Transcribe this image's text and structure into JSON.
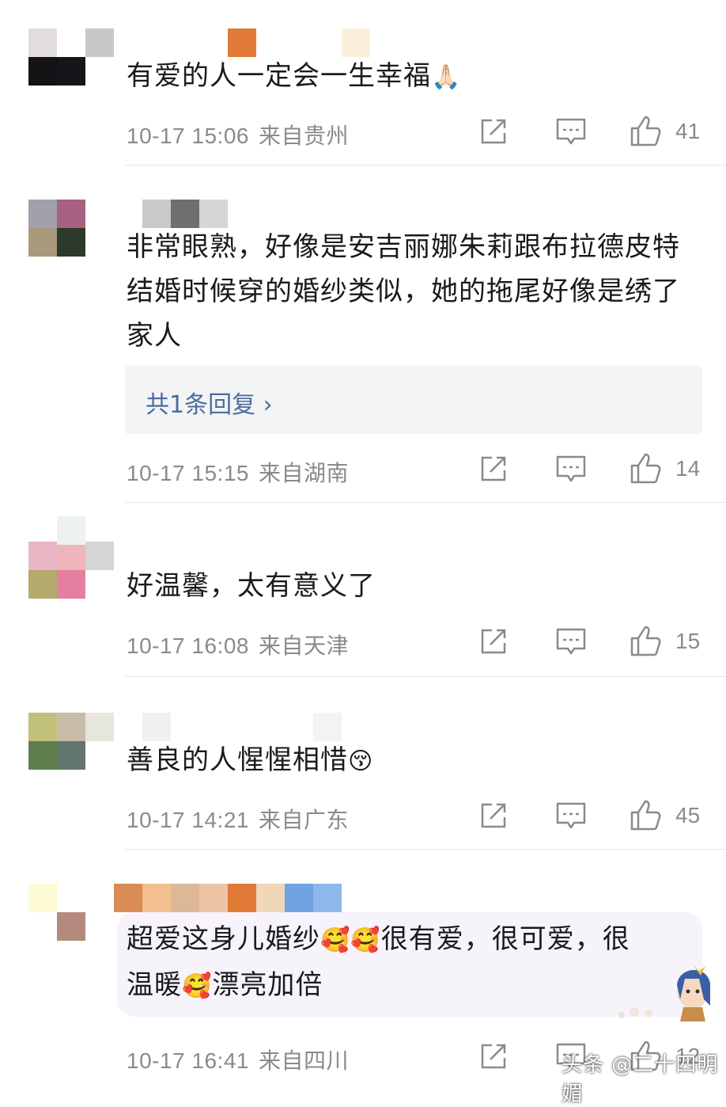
{
  "comments": [
    {
      "text": "有爱的人一定会一生幸福",
      "emoji": "🙏🏻",
      "date": "10-17 15:06",
      "location": "来自贵州",
      "likes": "41",
      "avatar_colors": [
        "#e2dce0",
        "#c7c9c8",
        "#131214",
        "#15161a"
      ],
      "name_colors": [
        "#f0f0f0",
        "#e07a36",
        "#fbefdc"
      ]
    },
    {
      "text": "非常眼熟，好像是安吉丽娜朱莉跟布拉德皮特结婚时候穿的婚纱类似，她的拖尾好像是绣了家人",
      "reply_label": "共1条回复",
      "reply_arrow": "›",
      "date": "10-17 15:15",
      "location": "来自湖南",
      "likes": "14",
      "avatar_colors": [
        "#a2a0ad",
        "#a66080",
        "#a89a7a",
        "#2c3a29"
      ],
      "name_colors": [
        "#c9c9c9",
        "#6f6f6f",
        "#d6d6d6"
      ]
    },
    {
      "text": "好温馨，太有意义了",
      "date": "10-17 16:08",
      "location": "来自天津",
      "likes": "15",
      "avatar_colors": [
        "#e9b6c3",
        "#efb5bc",
        "#b4ab6c",
        "#e57fa0"
      ],
      "name_colors": [
        "#eef2ef"
      ]
    },
    {
      "text": "善良的人惺惺相惜",
      "emoji": "😚",
      "date": "10-17 14:21",
      "location": "来自广东",
      "likes": "45",
      "avatar_colors": [
        "#c1c17b",
        "#c8bca6",
        "#5f7e4d",
        "#62756e"
      ],
      "name_colors": [
        "#f0f0f0",
        "#f3f3f3"
      ]
    },
    {
      "text_line1_a": "超爱这身儿婚纱",
      "text_line1_emoji": "🥰🥰",
      "text_line1_b": "很有爱，很可爱，很",
      "text_line2_a": "温暖",
      "text_line2_emoji": "🥰",
      "text_line2_b": "漂亮加倍",
      "date": "10-17 16:41",
      "location": "来自四川",
      "likes": "12",
      "avatar_colors": [
        "#fbfad5",
        "#ffffff",
        "#ffffff",
        "#b48a7c"
      ],
      "name_colors": [
        "#d98c55",
        "#f2c08f",
        "#dcb898",
        "#ebc5a6",
        "#e07a36",
        "#f0d7b8",
        "#70a3e3",
        "#8fb8ea"
      ]
    }
  ],
  "icons": {
    "share": "share-icon",
    "comment": "comment-icon",
    "like": "thumbs-up-icon"
  },
  "watermark": "头条 @二十四明媚"
}
